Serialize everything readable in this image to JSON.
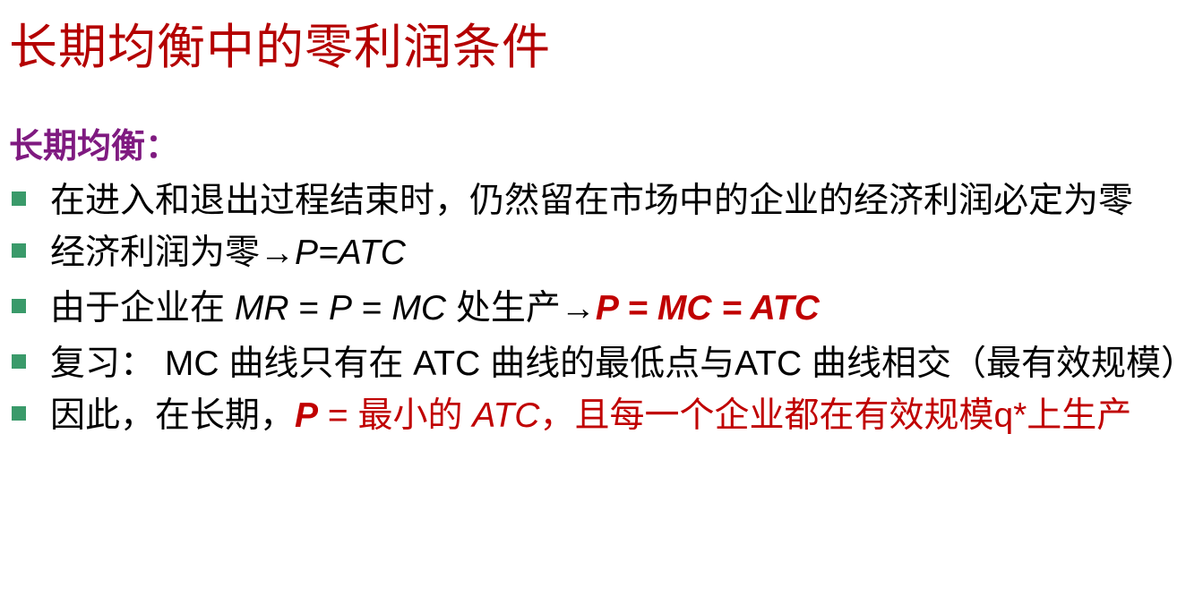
{
  "slide": {
    "title": "长期均衡中的零利润条件",
    "subheading": "长期均衡：",
    "bullets": [
      {
        "text": "在进入和退出过程结束时，仍然留在市场中的企业的经济利润必定为零"
      },
      {
        "p1": "经济利润为零",
        "arrow": "→",
        "p2": "P=ATC"
      },
      {
        "p1": "由于企业在 ",
        "p2": "MR",
        "p3": " = ",
        "p4": "P",
        "p5": " = ",
        "p6": "MC",
        "p7": " 处生产",
        "arrow": "→",
        "p8": "P = MC = ATC"
      },
      {
        "text": "复习： MC 曲线只有在 ATC 曲线的最低点与ATC 曲线相交（最有效规模）"
      },
      {
        "p1": "因此，在长期，",
        "p2": "P",
        "p3": " = 最小的 ",
        "p4": "ATC",
        "p5": "，且每一个企业都在有效规模q*上生产"
      }
    ]
  },
  "colors": {
    "title": "#b40000",
    "subheading": "#7f1a80",
    "bullet_marker": "#3a9a6a",
    "emphasis_red": "#c00000"
  }
}
